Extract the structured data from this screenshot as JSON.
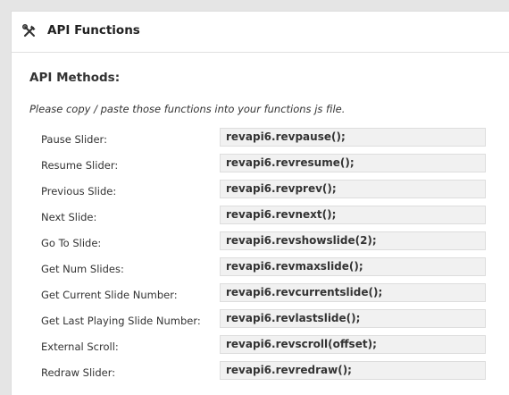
{
  "header": {
    "icon": "tools-icon",
    "title": "API Functions"
  },
  "section": {
    "title": "API Methods:",
    "description": "Please copy / paste those functions into your functions js file."
  },
  "methods": [
    {
      "label": "Pause Slider:",
      "code": "revapi6.revpause();"
    },
    {
      "label": "Resume Slider:",
      "code": "revapi6.revresume();"
    },
    {
      "label": "Previous Slide:",
      "code": "revapi6.revprev();"
    },
    {
      "label": "Next Slide:",
      "code": "revapi6.revnext();"
    },
    {
      "label": "Go To Slide:",
      "code": "revapi6.revshowslide(2);"
    },
    {
      "label": "Get Num Slides:",
      "code": "revapi6.revmaxslide();"
    },
    {
      "label": "Get Current Slide Number:",
      "code": "revapi6.revcurrentslide();"
    },
    {
      "label": "Get Last Playing Slide Number:",
      "code": "revapi6.revlastslide();"
    },
    {
      "label": "External Scroll:",
      "code": "revapi6.revscroll(offset);"
    },
    {
      "label": "Redraw Slider:",
      "code": "revapi6.revredraw();"
    }
  ]
}
